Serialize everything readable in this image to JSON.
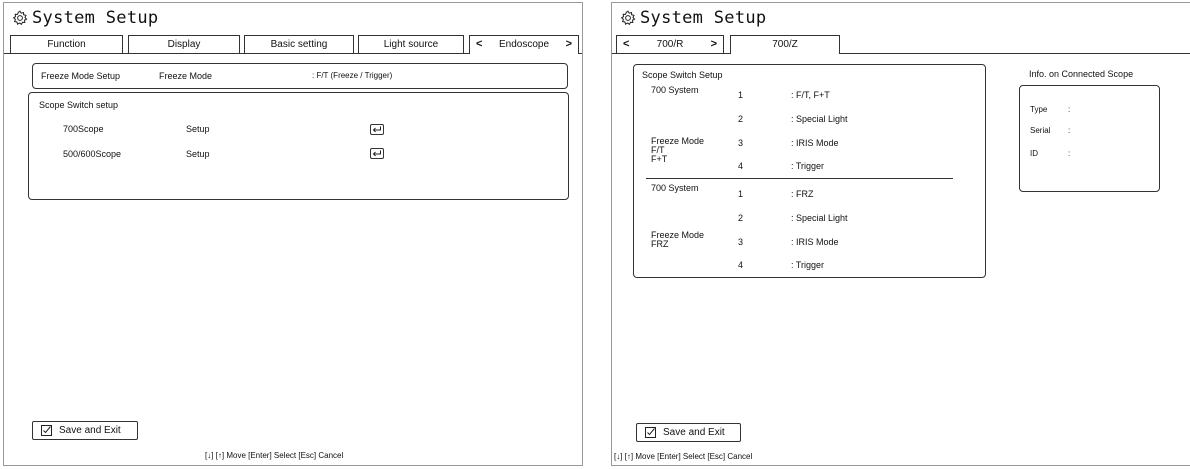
{
  "left": {
    "title": "System Setup",
    "tabs": [
      "Function",
      "Display",
      "Basic setting",
      "Light source",
      "Endoscope"
    ],
    "tab_prev": "<",
    "tab_next": ">",
    "freeze_row": {
      "label": "Freeze Mode Setup",
      "name": "Freeze Mode",
      "value": ": F/T (Freeze / Trigger)"
    },
    "scope_switch": {
      "title": "Scope Switch setup",
      "rows": [
        {
          "name": "700Scope",
          "action": "Setup"
        },
        {
          "name": "500/600Scope",
          "action": "Setup"
        }
      ]
    },
    "save_label": "Save and Exit",
    "hint": "[↓] [↑] Move [Enter] Select [Esc] Cancel"
  },
  "right": {
    "title": "System Setup",
    "tabs": [
      "700/R",
      "700/Z"
    ],
    "tab_prev": "<",
    "tab_next": ">",
    "scope_switch": {
      "title": "Scope Switch Setup",
      "group1": {
        "system": "700 System",
        "mode_lines": [
          "Freeze Mode",
          "F/T",
          "F+T"
        ],
        "buttons": [
          {
            "num": "1",
            "label": ": F/T, F+T"
          },
          {
            "num": "2",
            "label": ": Special Light"
          },
          {
            "num": "3",
            "label": ": IRIS Mode"
          },
          {
            "num": "4",
            "label": ": Trigger"
          }
        ]
      },
      "group2": {
        "system": "700 System",
        "mode_lines": [
          "Freeze Mode",
          "FRZ"
        ],
        "buttons": [
          {
            "num": "1",
            "label": ": FRZ"
          },
          {
            "num": "2",
            "label": ": Special Light"
          },
          {
            "num": "3",
            "label": ": IRIS Mode"
          },
          {
            "num": "4",
            "label": ": Trigger"
          }
        ]
      }
    },
    "info": {
      "title": "Info. on Connected Scope",
      "fields": [
        {
          "label": "Type",
          "sep": ":"
        },
        {
          "label": "Serial",
          "sep": ":"
        },
        {
          "label": "ID",
          "sep": ":"
        }
      ]
    },
    "save_label": "Save and Exit",
    "hint": "[↓] [↑] Move [Enter] Select [Esc] Cancel"
  }
}
